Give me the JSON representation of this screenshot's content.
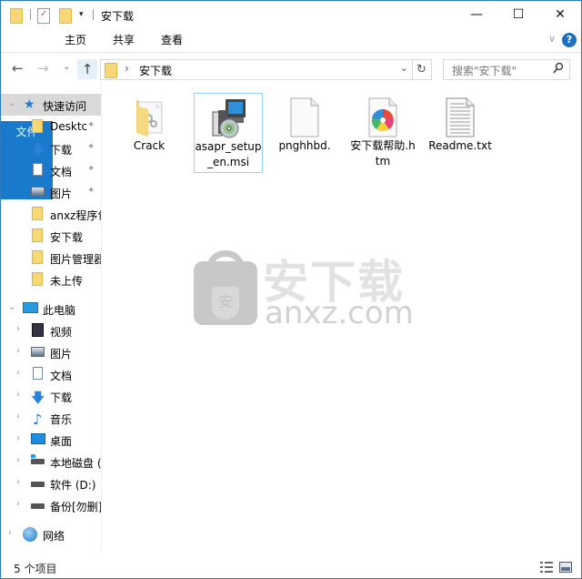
{
  "window": {
    "title": "安下载",
    "controls": {
      "minimize": "—",
      "maximize": "☐",
      "close": "✕"
    }
  },
  "quick_access_toolbar": {
    "icons": [
      "folder-icon",
      "properties-icon",
      "new-folder-icon",
      "customize-dropdown-icon"
    ]
  },
  "ribbon": {
    "tabs": [
      {
        "label": "文件",
        "active": true
      },
      {
        "label": "主页"
      },
      {
        "label": "共享"
      },
      {
        "label": "查看"
      }
    ],
    "expand_glyph": "∨",
    "help_glyph": "?"
  },
  "navigation": {
    "back_glyph": "←",
    "forward_glyph": "→",
    "recent_glyph": "⌄",
    "up_glyph": "↑",
    "breadcrumb": [
      "安下载"
    ],
    "breadcrumb_sep": "›",
    "address_dropdown_glyph": "⌄",
    "refresh_glyph": "↻",
    "search_placeholder": "搜索\"安下载\"",
    "search_glyph": "⚲"
  },
  "sidebar": {
    "quick_access": {
      "label": "快速访问",
      "items": [
        {
          "label": "Desktc",
          "icon": "folder",
          "pinned": true
        },
        {
          "label": "下载",
          "icon": "download",
          "pinned": true
        },
        {
          "label": "文档",
          "icon": "document",
          "pinned": true
        },
        {
          "label": "图片",
          "icon": "picture",
          "pinned": true
        },
        {
          "label": "anxz程序包",
          "icon": "folder",
          "pinned": false
        },
        {
          "label": "安下载",
          "icon": "folder",
          "pinned": false
        },
        {
          "label": "图片管理器",
          "icon": "folder",
          "pinned": false
        },
        {
          "label": "未上传",
          "icon": "folder",
          "pinned": false
        }
      ]
    },
    "this_pc": {
      "label": "此电脑",
      "items": [
        {
          "label": "视频",
          "icon": "video"
        },
        {
          "label": "图片",
          "icon": "picture"
        },
        {
          "label": "文档",
          "icon": "document"
        },
        {
          "label": "下载",
          "icon": "download"
        },
        {
          "label": "音乐",
          "icon": "music"
        },
        {
          "label": "桌面",
          "icon": "desktop"
        },
        {
          "label": "本地磁盘 (C:)",
          "icon": "system-drive"
        },
        {
          "label": "软件 (D:)",
          "icon": "drive"
        },
        {
          "label": "备份[勿删] (E:)",
          "icon": "drive"
        }
      ]
    },
    "network": {
      "label": "网络"
    },
    "pin_glyph": "📌"
  },
  "files": [
    {
      "name": "Crack",
      "type": "folder",
      "selected": false
    },
    {
      "name": "asapr_setup_en.msi",
      "type": "msi",
      "selected": true
    },
    {
      "name": "pnghhbd.",
      "type": "blank",
      "selected": false
    },
    {
      "name": "安下载帮助.htm",
      "type": "htm",
      "selected": false
    },
    {
      "name": "Readme.txt",
      "type": "txt",
      "selected": false
    }
  ],
  "watermark": {
    "cn": "安下载",
    "en": "anxz.com",
    "badge": "安"
  },
  "status_bar": {
    "item_count": "5 个项目"
  }
}
